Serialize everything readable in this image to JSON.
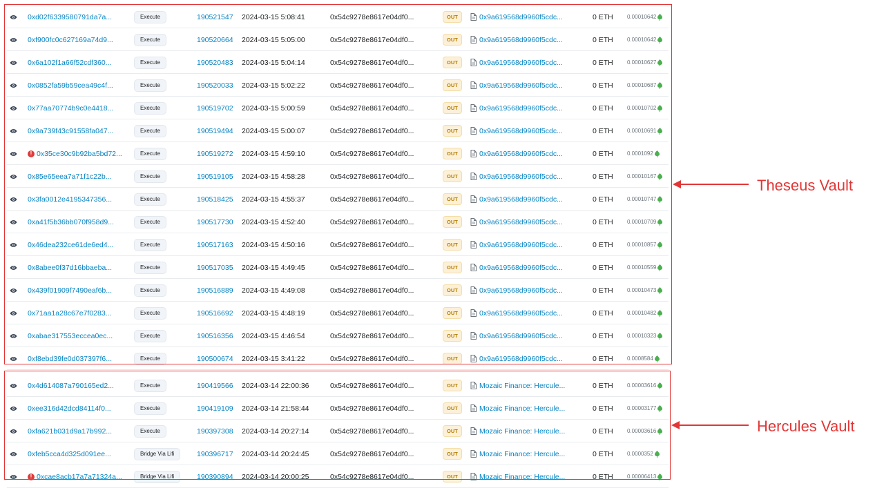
{
  "colors": {
    "link": "#0784c3",
    "annotation": "#e23636",
    "error": "#de3c3c",
    "out_badge_bg": "#fcf0d8",
    "out_badge_text": "#b47d00",
    "gas_icon": "#4caf50"
  },
  "icons": {
    "view": "eye-icon",
    "error": "exclamation-circle-icon",
    "contract": "document-icon",
    "fee": "gas-icon"
  },
  "annotations": {
    "theseus": "Theseus Vault",
    "hercules": "Hercules Vault"
  },
  "transactions": [
    {
      "hash": "0xd02f6339580791da7a...",
      "method": "Execute",
      "block": "190521547",
      "age": "2024-03-15 5:08:41",
      "from": "0x54c9278e8617e04df0...",
      "direction": "OUT",
      "to": "0x9a619568d9960f5cdc...",
      "value": "0 ETH",
      "fee": "0.00010642",
      "error": false
    },
    {
      "hash": "0xf900fc0c627169a74d9...",
      "method": "Execute",
      "block": "190520664",
      "age": "2024-03-15 5:05:00",
      "from": "0x54c9278e8617e04df0...",
      "direction": "OUT",
      "to": "0x9a619568d9960f5cdc...",
      "value": "0 ETH",
      "fee": "0.00010642",
      "error": false
    },
    {
      "hash": "0x6a102f1a66f52cdf360...",
      "method": "Execute",
      "block": "190520483",
      "age": "2024-03-15 5:04:14",
      "from": "0x54c9278e8617e04df0...",
      "direction": "OUT",
      "to": "0x9a619568d9960f5cdc...",
      "value": "0 ETH",
      "fee": "0.00010627",
      "error": false
    },
    {
      "hash": "0x0852fa59b59cea49c4f...",
      "method": "Execute",
      "block": "190520033",
      "age": "2024-03-15 5:02:22",
      "from": "0x54c9278e8617e04df0...",
      "direction": "OUT",
      "to": "0x9a619568d9960f5cdc...",
      "value": "0 ETH",
      "fee": "0.00010687",
      "error": false
    },
    {
      "hash": "0x77aa70774b9c0e4418...",
      "method": "Execute",
      "block": "190519702",
      "age": "2024-03-15 5:00:59",
      "from": "0x54c9278e8617e04df0...",
      "direction": "OUT",
      "to": "0x9a619568d9960f5cdc...",
      "value": "0 ETH",
      "fee": "0.00010702",
      "error": false
    },
    {
      "hash": "0x9a739f43c91558fa047...",
      "method": "Execute",
      "block": "190519494",
      "age": "2024-03-15 5:00:07",
      "from": "0x54c9278e8617e04df0...",
      "direction": "OUT",
      "to": "0x9a619568d9960f5cdc...",
      "value": "0 ETH",
      "fee": "0.00010691",
      "error": false
    },
    {
      "hash": "0x35ce30c9b92ba5bd72...",
      "method": "Execute",
      "block": "190519272",
      "age": "2024-03-15 4:59:10",
      "from": "0x54c9278e8617e04df0...",
      "direction": "OUT",
      "to": "0x9a619568d9960f5cdc...",
      "value": "0 ETH",
      "fee": "0.0001092",
      "error": true
    },
    {
      "hash": "0x85e65eea7a71f1c22b...",
      "method": "Execute",
      "block": "190519105",
      "age": "2024-03-15 4:58:28",
      "from": "0x54c9278e8617e04df0...",
      "direction": "OUT",
      "to": "0x9a619568d9960f5cdc...",
      "value": "0 ETH",
      "fee": "0.00010167",
      "error": false
    },
    {
      "hash": "0x3fa0012e4195347356...",
      "method": "Execute",
      "block": "190518425",
      "age": "2024-03-15 4:55:37",
      "from": "0x54c9278e8617e04df0...",
      "direction": "OUT",
      "to": "0x9a619568d9960f5cdc...",
      "value": "0 ETH",
      "fee": "0.00010747",
      "error": false
    },
    {
      "hash": "0xa41f5b36bb070f958d9...",
      "method": "Execute",
      "block": "190517730",
      "age": "2024-03-15 4:52:40",
      "from": "0x54c9278e8617e04df0...",
      "direction": "OUT",
      "to": "0x9a619568d9960f5cdc...",
      "value": "0 ETH",
      "fee": "0.00010709",
      "error": false
    },
    {
      "hash": "0x46dea232ce61de6ed4...",
      "method": "Execute",
      "block": "190517163",
      "age": "2024-03-15 4:50:16",
      "from": "0x54c9278e8617e04df0...",
      "direction": "OUT",
      "to": "0x9a619568d9960f5cdc...",
      "value": "0 ETH",
      "fee": "0.00010857",
      "error": false
    },
    {
      "hash": "0x8abee0f37d16bbaeba...",
      "method": "Execute",
      "block": "190517035",
      "age": "2024-03-15 4:49:45",
      "from": "0x54c9278e8617e04df0...",
      "direction": "OUT",
      "to": "0x9a619568d9960f5cdc...",
      "value": "0 ETH",
      "fee": "0.00010559",
      "error": false
    },
    {
      "hash": "0x439f01909f7490eaf6b...",
      "method": "Execute",
      "block": "190516889",
      "age": "2024-03-15 4:49:08",
      "from": "0x54c9278e8617e04df0...",
      "direction": "OUT",
      "to": "0x9a619568d9960f5cdc...",
      "value": "0 ETH",
      "fee": "0.00010473",
      "error": false
    },
    {
      "hash": "0x71aa1a28c67e7f0283...",
      "method": "Execute",
      "block": "190516692",
      "age": "2024-03-15 4:48:19",
      "from": "0x54c9278e8617e04df0...",
      "direction": "OUT",
      "to": "0x9a619568d9960f5cdc...",
      "value": "0 ETH",
      "fee": "0.00010482",
      "error": false
    },
    {
      "hash": "0xabae317553eccea0ec...",
      "method": "Execute",
      "block": "190516356",
      "age": "2024-03-15 4:46:54",
      "from": "0x54c9278e8617e04df0...",
      "direction": "OUT",
      "to": "0x9a619568d9960f5cdc...",
      "value": "0 ETH",
      "fee": "0.00010323",
      "error": false
    },
    {
      "hash": "0xf8ebd39fe0d037397f6...",
      "method": "Execute",
      "block": "190500674",
      "age": "2024-03-15 3:41:22",
      "from": "0x54c9278e8617e04df0...",
      "direction": "OUT",
      "to": "0x9a619568d9960f5cdc...",
      "value": "0 ETH",
      "fee": "0.0008584",
      "error": false
    },
    {
      "hash": "0x4d614087a790165ed2...",
      "method": "Execute",
      "block": "190419566",
      "age": "2024-03-14 22:00:36",
      "from": "0x54c9278e8617e04df0...",
      "direction": "OUT",
      "to": "Mozaic Finance: Hercule...",
      "value": "0 ETH",
      "fee": "0.00003616",
      "error": false
    },
    {
      "hash": "0xee316d42dcd84114f0...",
      "method": "Execute",
      "block": "190419109",
      "age": "2024-03-14 21:58:44",
      "from": "0x54c9278e8617e04df0...",
      "direction": "OUT",
      "to": "Mozaic Finance: Hercule...",
      "value": "0 ETH",
      "fee": "0.00003177",
      "error": false
    },
    {
      "hash": "0xfa621b031d9a17b992...",
      "method": "Execute",
      "block": "190397308",
      "age": "2024-03-14 20:27:14",
      "from": "0x54c9278e8617e04df0...",
      "direction": "OUT",
      "to": "Mozaic Finance: Hercule...",
      "value": "0 ETH",
      "fee": "0.00003616",
      "error": false
    },
    {
      "hash": "0xfeb5cca4d325d091ee...",
      "method": "Bridge Via Lifi",
      "block": "190396717",
      "age": "2024-03-14 20:24:45",
      "from": "0x54c9278e8617e04df0...",
      "direction": "OUT",
      "to": "Mozaic Finance: Hercule...",
      "value": "0 ETH",
      "fee": "0.0000352",
      "error": false
    },
    {
      "hash": "0xcae8acb17a7a71324a...",
      "method": "Bridge Via Lifi",
      "block": "190390894",
      "age": "2024-03-14 20:00:25",
      "from": "0x54c9278e8617e04df0...",
      "direction": "OUT",
      "to": "Mozaic Finance: Hercule...",
      "value": "0 ETH",
      "fee": "0.00006413",
      "error": true
    }
  ]
}
